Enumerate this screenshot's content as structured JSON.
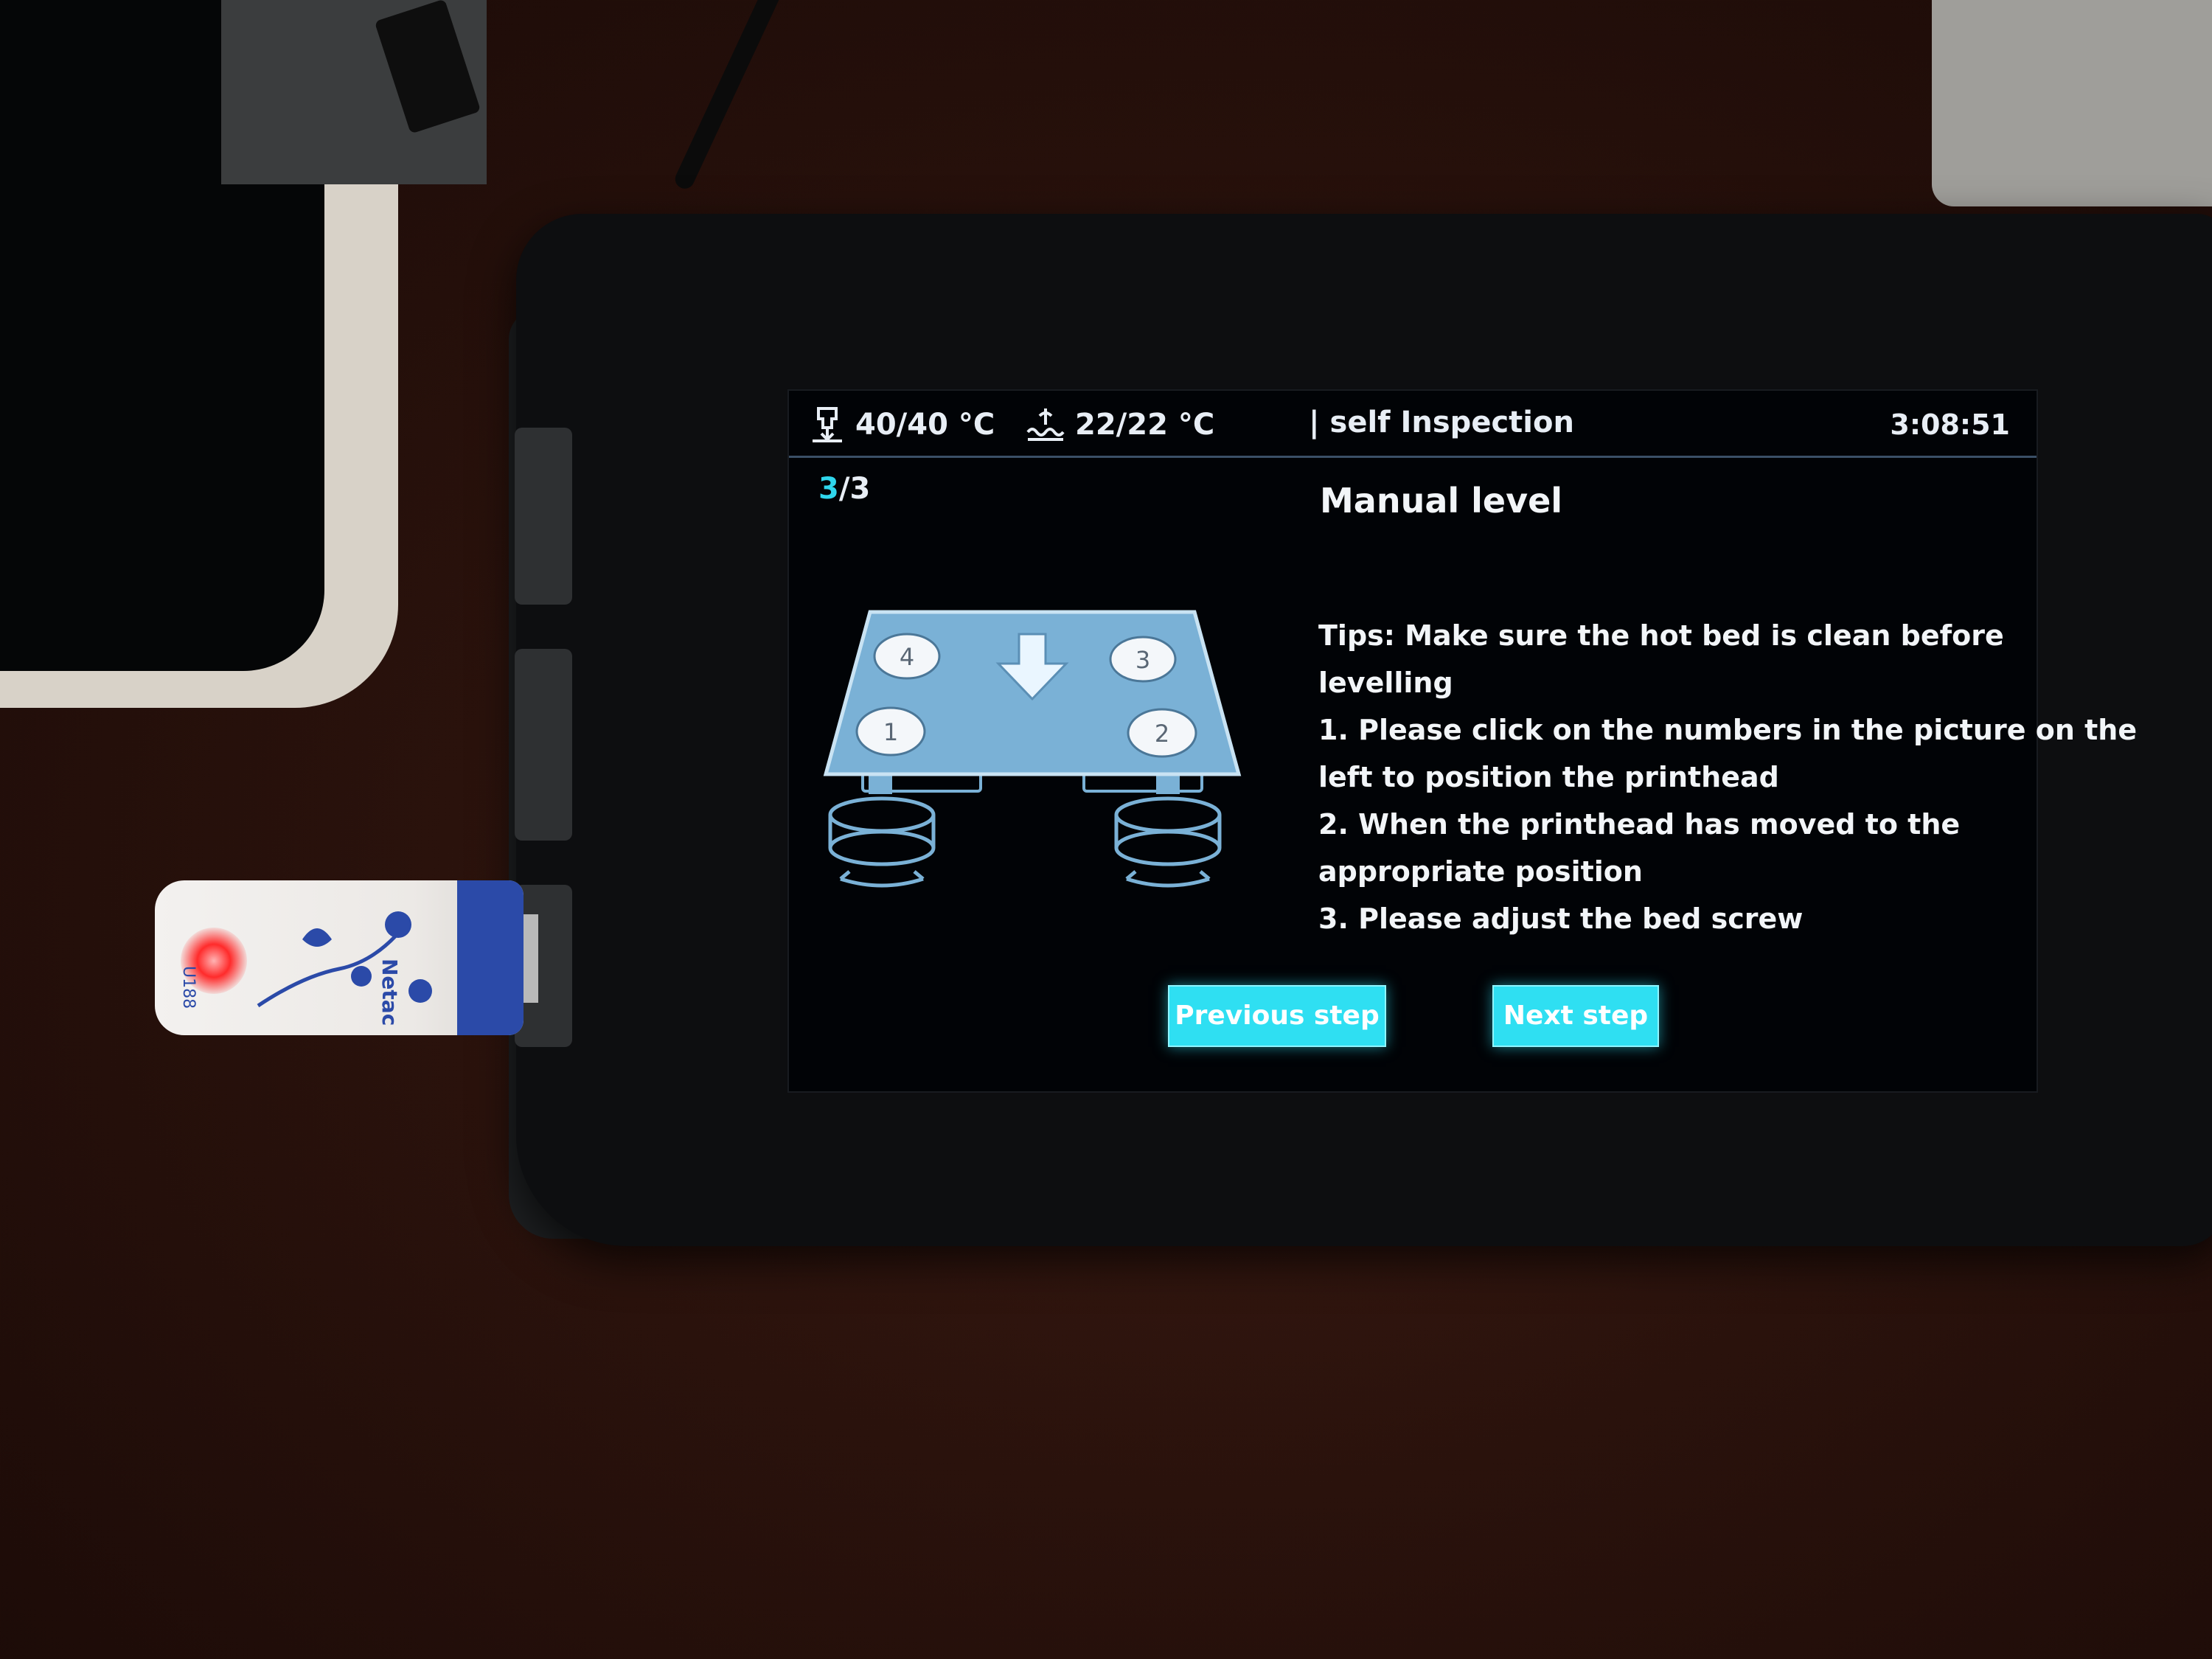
{
  "status_bar": {
    "nozzle_temp": "40/40 °C",
    "bed_temp": "22/22 °C",
    "section_label": "| self Inspection",
    "clock": "3:08:51"
  },
  "step": {
    "current": "3",
    "total_suffix": "/3"
  },
  "page": {
    "title": "Manual level"
  },
  "tips": {
    "lines": [
      "Tips: Make sure the hot bed is clean before",
      "levelling",
      "1. Please click on the numbers in the picture on the",
      "left to position the printhead",
      "2. When the printhead has moved to the",
      "appropriate position",
      "3. Please adjust the bed screw"
    ]
  },
  "bed_diagram": {
    "points": [
      "4",
      "3",
      "1",
      "2"
    ]
  },
  "buttons": {
    "previous": "Previous step",
    "next": "Next step"
  },
  "usb_stick": {
    "brand": "Netac",
    "model": "U188"
  },
  "colors": {
    "accent": "#2fdff2",
    "screen_bg": "#010306",
    "bed_fill": "#7ab1d6"
  }
}
